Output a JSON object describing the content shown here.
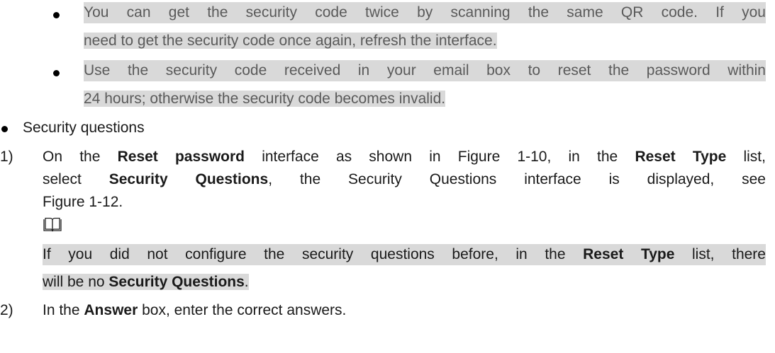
{
  "notes": {
    "n1_l1": "You can get the security code twice by scanning the same QR code. If you",
    "n1_l2": "need to get the security code once again, refresh the interface.",
    "n2_l1": "Use the security code received in your email box to reset the password within",
    "n2_l2": "24 hours; otherwise the security code becomes invalid."
  },
  "section": {
    "label": "Security questions"
  },
  "step1": {
    "number": "1)",
    "l1_a": "On the ",
    "l1_b1": "Reset password",
    "l1_c": " interface as shown in Figure 1-10, in the ",
    "l1_b2": "Reset Type",
    "l1_d": " list,",
    "l2_a": "select ",
    "l2_b": "Security Questions",
    "l2_c": ", the Security Questions interface is displayed, see",
    "l3": "Figure 1-12.",
    "note_l1_a": "If you did not configure the security questions before, in the ",
    "note_l1_b": "Reset Type",
    "note_l1_c": " list, there",
    "note_l2_a": "will be no ",
    "note_l2_b": "Security Questions",
    "note_l2_c": "."
  },
  "step2": {
    "number": "2)",
    "a": "In the ",
    "b": "Answer",
    "c": " box, enter the correct answers."
  },
  "icons": {
    "note": "book-note-icon",
    "bullet": "bullet-icon"
  }
}
